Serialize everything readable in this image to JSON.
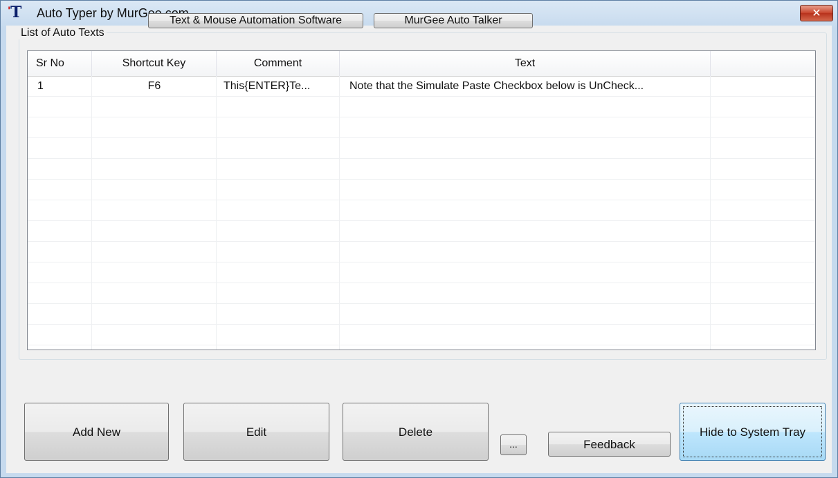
{
  "window": {
    "title": "Auto Typer by MurGee.com",
    "icon": "T",
    "close_label": "✕"
  },
  "top_buttons": {
    "automation_software": "Text & Mouse Automation Software",
    "auto_talker": "MurGee Auto Talker"
  },
  "group": {
    "label": "List of Auto Texts"
  },
  "table": {
    "columns": [
      "Sr No",
      "Shortcut Key",
      "Comment",
      "Text",
      ""
    ],
    "rows": [
      {
        "sr_no": "1",
        "shortcut": "F6",
        "comment": "This{ENTER}Te...",
        "text": "Note that the Simulate Paste Checkbox below is UnCheck..."
      }
    ]
  },
  "buttons": {
    "add_new": "Add New",
    "edit": "Edit",
    "delete": "Delete",
    "more": "...",
    "feedback": "Feedback",
    "hide_tray": "Hide to System Tray"
  },
  "colors": {
    "title_bar": "#c6daee",
    "close_button": "#c7432b",
    "client_bg": "#f0f0f0"
  }
}
